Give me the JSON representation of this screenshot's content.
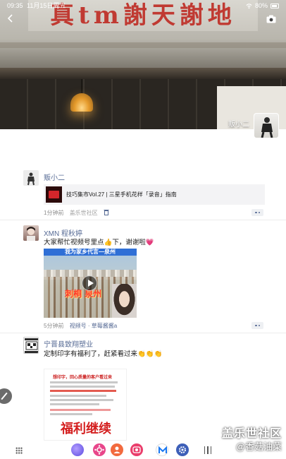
{
  "status_bar": {
    "time": "09:35",
    "date": "11月15日周五",
    "battery": "80%"
  },
  "cover": {
    "sign_text": "真tm謝天謝地",
    "owner_name": "贩小二"
  },
  "posts": [
    {
      "author": "贩小二",
      "share_title": "技巧集市Vol.27 | 三星手机花样「录音」指南",
      "time": "1分钟前",
      "source": "盖乐世社区"
    },
    {
      "author": "XMN 程秋婷",
      "text": "大家帮忙视频号里点👍下，谢谢啦💗",
      "video_banner": "我为家乡代言—泉州",
      "video_caption": "刺桐 泉州",
      "time": "5分钟前",
      "source": "视频号 · 草莓酱酱a"
    },
    {
      "author": "宁晋县致翔塑业",
      "text": "定制印字有福利了，赶紧看过来👏👏👏",
      "poster_head": "想印字，回心质量的客户看过来",
      "poster_banner": "福利继续"
    }
  ],
  "watermark": {
    "line1": "盖乐世社区",
    "line2": "@香菇油菜"
  },
  "colors": {
    "link": "#576b95",
    "meta": "#8c8c8c",
    "background": "#ffffff"
  },
  "icons": [
    "back-arrow-icon",
    "camera-icon",
    "more-icon",
    "delete-icon",
    "play-icon",
    "edit-icon",
    "apps-grid-icon",
    "recents-icon"
  ]
}
